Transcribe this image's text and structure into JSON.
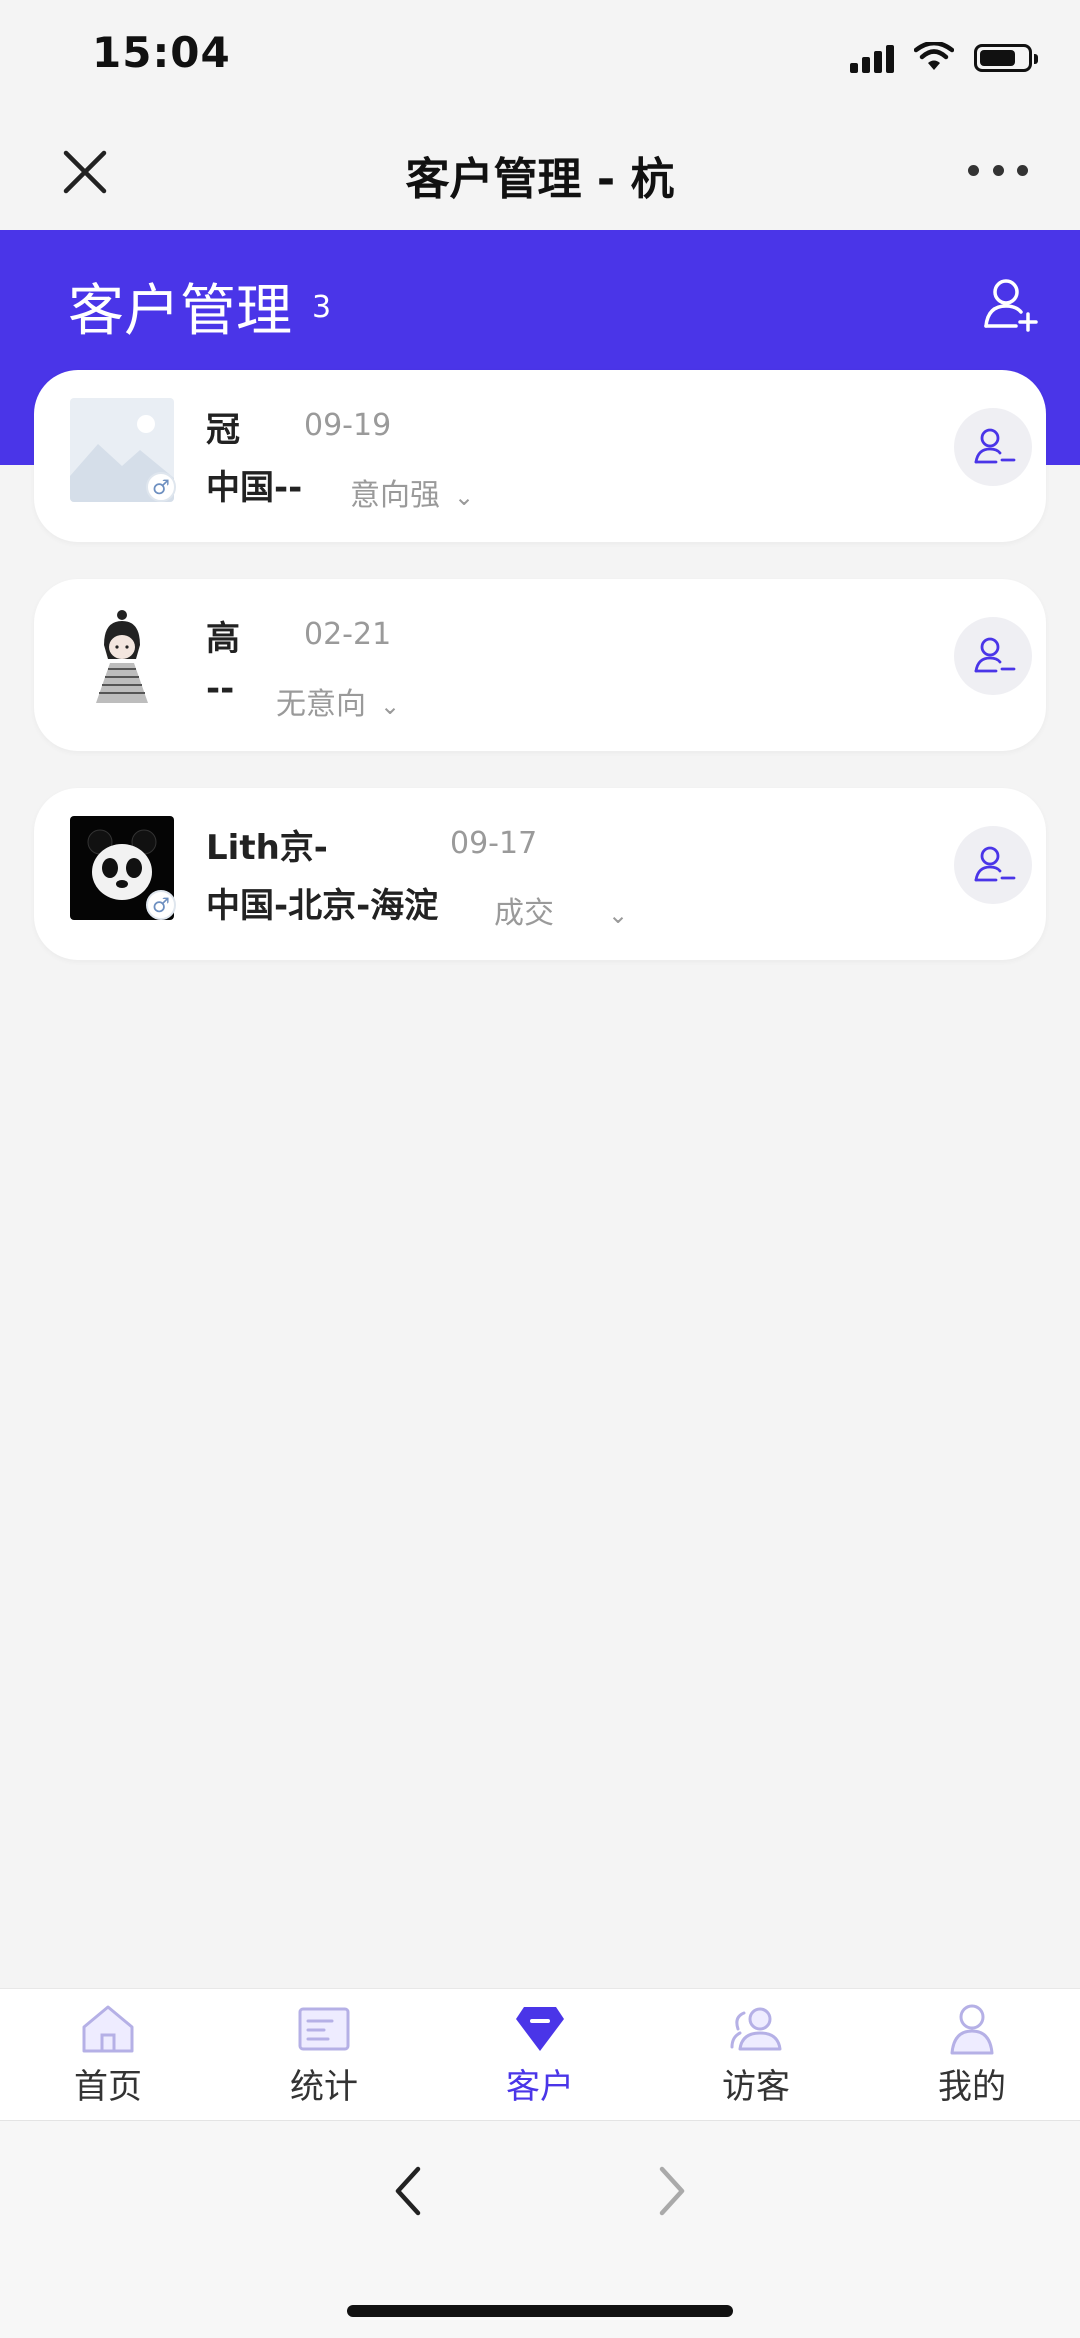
{
  "status_bar": {
    "time": "15:04"
  },
  "title_bar": {
    "title": "客户管理 - 杭"
  },
  "header": {
    "title": "客户管理",
    "count": "3",
    "accent_color": "#4a35e8"
  },
  "customers": [
    {
      "name": "冠",
      "date": "09-19",
      "region": "中国--",
      "intent": "意向强",
      "avatar": "placeholder-image",
      "gender": "male"
    },
    {
      "name": "高",
      "date": "02-21",
      "region": "--",
      "intent": "无意向",
      "avatar": "cartoon-girl",
      "gender": ""
    },
    {
      "name": "Lith京-",
      "date": "09-17",
      "region": "中国-北京-海淀",
      "intent": "成交",
      "avatar": "panda",
      "gender": "male"
    }
  ],
  "tabs": [
    {
      "label": "首页",
      "icon": "home-icon"
    },
    {
      "label": "统计",
      "icon": "stats-icon"
    },
    {
      "label": "客户",
      "icon": "customer-icon",
      "active": true
    },
    {
      "label": "访客",
      "icon": "visitors-icon"
    },
    {
      "label": "我的",
      "icon": "profile-icon"
    }
  ],
  "browser_nav": {
    "back_icon": "chevron-left-icon",
    "forward_icon": "chevron-right-icon"
  }
}
